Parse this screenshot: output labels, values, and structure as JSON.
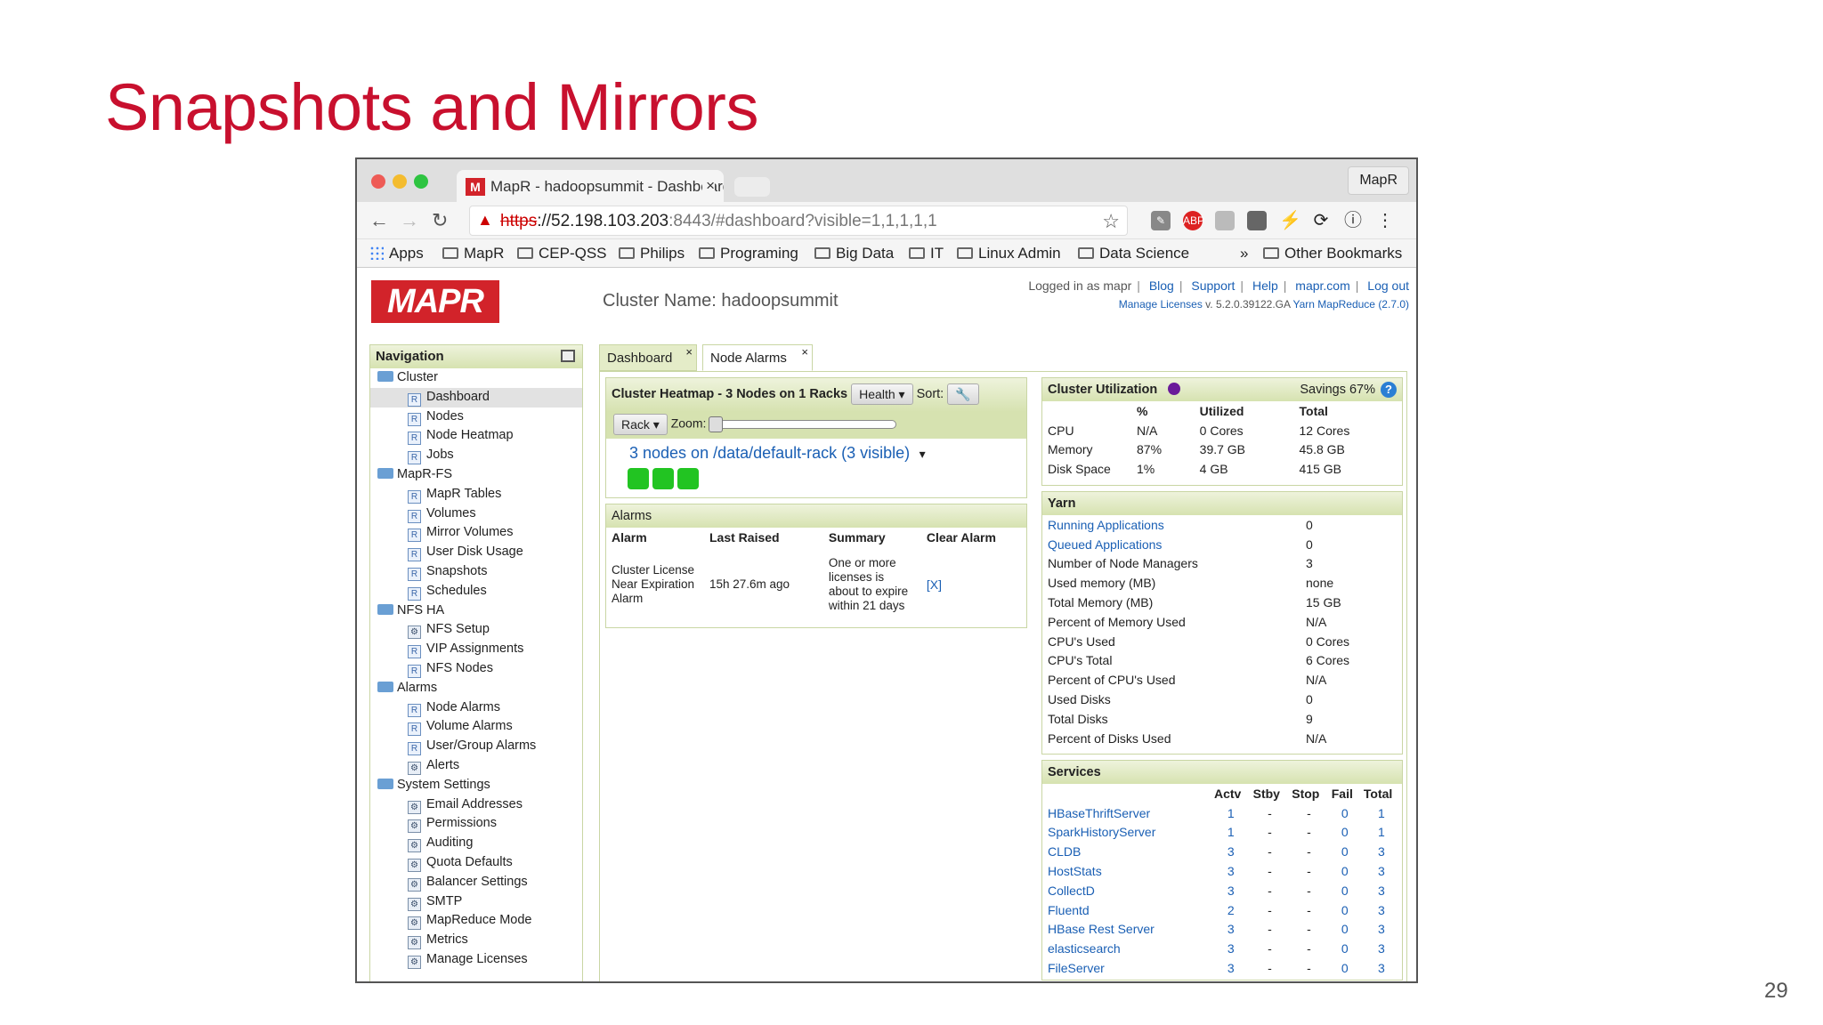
{
  "slide": {
    "title": "Snapshots and Mirrors",
    "page_number": "29"
  },
  "browser": {
    "tab_title": "MapR - hadoopsummit - Dashboard",
    "tab_close": "×",
    "profile": "MapR",
    "url": {
      "scheme": "https",
      "host": "://52.198.103.203",
      "rest": ":8443/#dashboard?visible=1,1,1,1,1"
    },
    "bookmarks": [
      "Apps",
      "MapR",
      "CEP-QSS",
      "Philips",
      "Programing",
      "Big Data",
      "IT",
      "Linux Admin",
      "Data Science"
    ],
    "bookmarks_more": "»",
    "other_bookmarks": "Other Bookmarks"
  },
  "header": {
    "logo": "MAPR",
    "cluster_name": "Cluster Name: hadoopsummit",
    "logged_in": "Logged in as mapr",
    "links": [
      "Blog",
      "Support",
      "Help",
      "mapr.com",
      "Log out"
    ],
    "manage_licenses": "Manage Licenses",
    "version": "v. 5.2.0.39122.GA",
    "yarn_version": "Yarn MapReduce (2.7.0)"
  },
  "navigation": {
    "title": "Navigation",
    "items": [
      {
        "type": "group",
        "label": "Cluster"
      },
      {
        "type": "leaf",
        "icon": "R",
        "label": "Dashboard",
        "selected": true
      },
      {
        "type": "leaf",
        "icon": "R",
        "label": "Nodes"
      },
      {
        "type": "leaf",
        "icon": "R",
        "label": "Node Heatmap"
      },
      {
        "type": "leaf",
        "icon": "R",
        "label": "Jobs"
      },
      {
        "type": "group",
        "label": "MapR-FS"
      },
      {
        "type": "leaf",
        "icon": "R",
        "label": "MapR Tables"
      },
      {
        "type": "leaf",
        "icon": "R",
        "label": "Volumes"
      },
      {
        "type": "leaf",
        "icon": "R",
        "label": "Mirror Volumes"
      },
      {
        "type": "leaf",
        "icon": "R",
        "label": "User Disk Usage"
      },
      {
        "type": "leaf",
        "icon": "R",
        "label": "Snapshots"
      },
      {
        "type": "leaf",
        "icon": "R",
        "label": "Schedules"
      },
      {
        "type": "group",
        "label": "NFS HA"
      },
      {
        "type": "leaf",
        "icon": "G",
        "label": "NFS Setup"
      },
      {
        "type": "leaf",
        "icon": "R",
        "label": "VIP Assignments"
      },
      {
        "type": "leaf",
        "icon": "R",
        "label": "NFS Nodes"
      },
      {
        "type": "group",
        "label": "Alarms"
      },
      {
        "type": "leaf",
        "icon": "R",
        "label": "Node Alarms"
      },
      {
        "type": "leaf",
        "icon": "R",
        "label": "Volume Alarms"
      },
      {
        "type": "leaf",
        "icon": "R",
        "label": "User/Group Alarms"
      },
      {
        "type": "leaf",
        "icon": "G",
        "label": "Alerts"
      },
      {
        "type": "group",
        "label": "System Settings"
      },
      {
        "type": "leaf",
        "icon": "G",
        "label": "Email Addresses"
      },
      {
        "type": "leaf",
        "icon": "G",
        "label": "Permissions"
      },
      {
        "type": "leaf",
        "icon": "G",
        "label": "Auditing"
      },
      {
        "type": "leaf",
        "icon": "G",
        "label": "Quota Defaults"
      },
      {
        "type": "leaf",
        "icon": "G",
        "label": "Balancer Settings"
      },
      {
        "type": "leaf",
        "icon": "G",
        "label": "SMTP"
      },
      {
        "type": "leaf",
        "icon": "G",
        "label": "MapReduce Mode"
      },
      {
        "type": "leaf",
        "icon": "G",
        "label": "Metrics"
      },
      {
        "type": "leaf",
        "icon": "G",
        "label": "Manage Licenses"
      }
    ]
  },
  "tabs": [
    {
      "label": "Dashboard",
      "close": "×"
    },
    {
      "label": "Node Alarms",
      "close": "×"
    }
  ],
  "heatmap": {
    "title": "Cluster Heatmap - 3 Nodes on 1 Racks",
    "health_btn": "Health",
    "sort_label": "Sort:",
    "rack_btn": "Rack",
    "zoom_label": "Zoom:",
    "rack_link": "3 nodes on /data/default-rack (3 visible)",
    "nodes": 3
  },
  "alarms": {
    "title": "Alarms",
    "columns": [
      "Alarm",
      "Last Raised",
      "Summary",
      "Clear Alarm"
    ],
    "rows": [
      {
        "alarm": "Cluster License Near Expiration Alarm",
        "last_raised": "15h 27.6m ago",
        "summary": "One or more licenses is about to expire within 21 days",
        "clear": "[X]"
      }
    ]
  },
  "utilization": {
    "title": "Cluster Utilization",
    "savings": "Savings 67%",
    "columns": [
      "",
      "%",
      "Utilized",
      "Total"
    ],
    "rows": [
      [
        "CPU",
        "N/A",
        "0 Cores",
        "12 Cores"
      ],
      [
        "Memory",
        "87%",
        "39.7 GB",
        "45.8 GB"
      ],
      [
        "Disk Space",
        "1%",
        "4 GB",
        "415 GB"
      ]
    ]
  },
  "yarn": {
    "title": "Yarn",
    "rows": [
      {
        "label": "Running Applications",
        "value": "0",
        "link": true
      },
      {
        "label": "Queued Applications",
        "value": "0",
        "link": true
      },
      {
        "label": "Number of Node Managers",
        "value": "3"
      },
      {
        "label": "Used memory (MB)",
        "value": "none"
      },
      {
        "label": "Total Memory (MB)",
        "value": "15 GB"
      },
      {
        "label": "Percent of Memory Used",
        "value": "N/A"
      },
      {
        "label": "CPU's Used",
        "value": "0 Cores"
      },
      {
        "label": "CPU's Total",
        "value": "6 Cores"
      },
      {
        "label": "Percent of CPU's Used",
        "value": "N/A"
      },
      {
        "label": "Used Disks",
        "value": "0"
      },
      {
        "label": "Total Disks",
        "value": "9"
      },
      {
        "label": "Percent of Disks Used",
        "value": "N/A"
      }
    ]
  },
  "services": {
    "title": "Services",
    "columns": [
      "",
      "Actv",
      "Stby",
      "Stop",
      "Fail",
      "Total"
    ],
    "rows": [
      [
        "HBaseThriftServer",
        "1",
        "-",
        "-",
        "0",
        "1"
      ],
      [
        "SparkHistoryServer",
        "1",
        "-",
        "-",
        "0",
        "1"
      ],
      [
        "CLDB",
        "3",
        "-",
        "-",
        "0",
        "3"
      ],
      [
        "HostStats",
        "3",
        "-",
        "-",
        "0",
        "3"
      ],
      [
        "CollectD",
        "3",
        "-",
        "-",
        "0",
        "3"
      ],
      [
        "Fluentd",
        "2",
        "-",
        "-",
        "0",
        "3"
      ],
      [
        "HBase Rest Server",
        "3",
        "-",
        "-",
        "0",
        "3"
      ],
      [
        "elasticsearch",
        "3",
        "-",
        "-",
        "0",
        "3"
      ],
      [
        "FileServer",
        "3",
        "-",
        "-",
        "0",
        "3"
      ]
    ]
  },
  "colors": {
    "title_red": "#c8102e",
    "mapr_red": "#d2232a",
    "panel_green": "#d6e2b0",
    "link_blue": "#1a5fb4",
    "node_green": "#22c422"
  }
}
